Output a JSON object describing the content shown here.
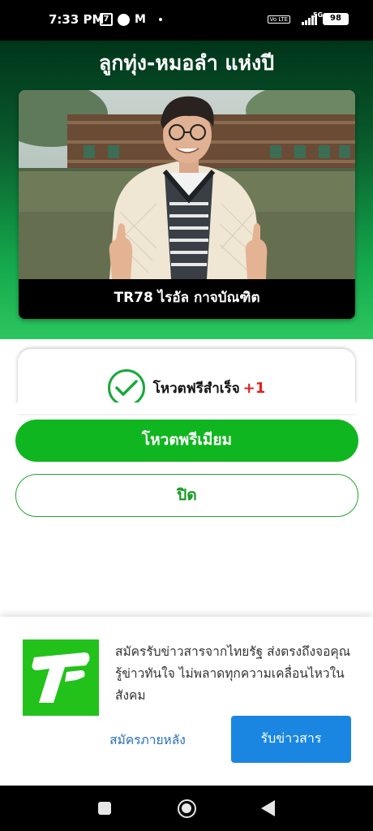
{
  "status_bar": {
    "time": "7:33 PM",
    "left_icons": [
      "seven-eleven-icon",
      "circle-app-icon",
      "gmail-icon",
      "dot-icon"
    ],
    "volte": "Vo LTE",
    "network": "5G",
    "battery": "98"
  },
  "header": {
    "title": "ลูกทุ่ง-หมอลำ แห่งปี"
  },
  "candidate": {
    "caption": "TR78 ไรอัล กาจบัณฑิต"
  },
  "vote": {
    "status_text": "โหวตฟรีสำเร็จ",
    "increment": "+1",
    "check_color": "#19a83c",
    "increment_color": "#e0211c"
  },
  "actions": {
    "premium_label": "โหวตพรีเมียม",
    "close_label": "ปิด",
    "accent": "#10b61f"
  },
  "subscribe": {
    "message": "สมัครรับข่าวสารจากไทยรัฐ ส่งตรงถึงจอคุณ รู้ข่าวทันใจ ไม่พลาดทุกความเคลื่อนไหวในสังคม",
    "later_label": "สมัครภายหลัง",
    "accept_label": "รับข่าวสาร",
    "logo_color": "#22c21b",
    "accept_color": "#1a86e2"
  },
  "nav": {
    "icons": [
      "recents-icon",
      "home-icon",
      "back-icon"
    ]
  }
}
